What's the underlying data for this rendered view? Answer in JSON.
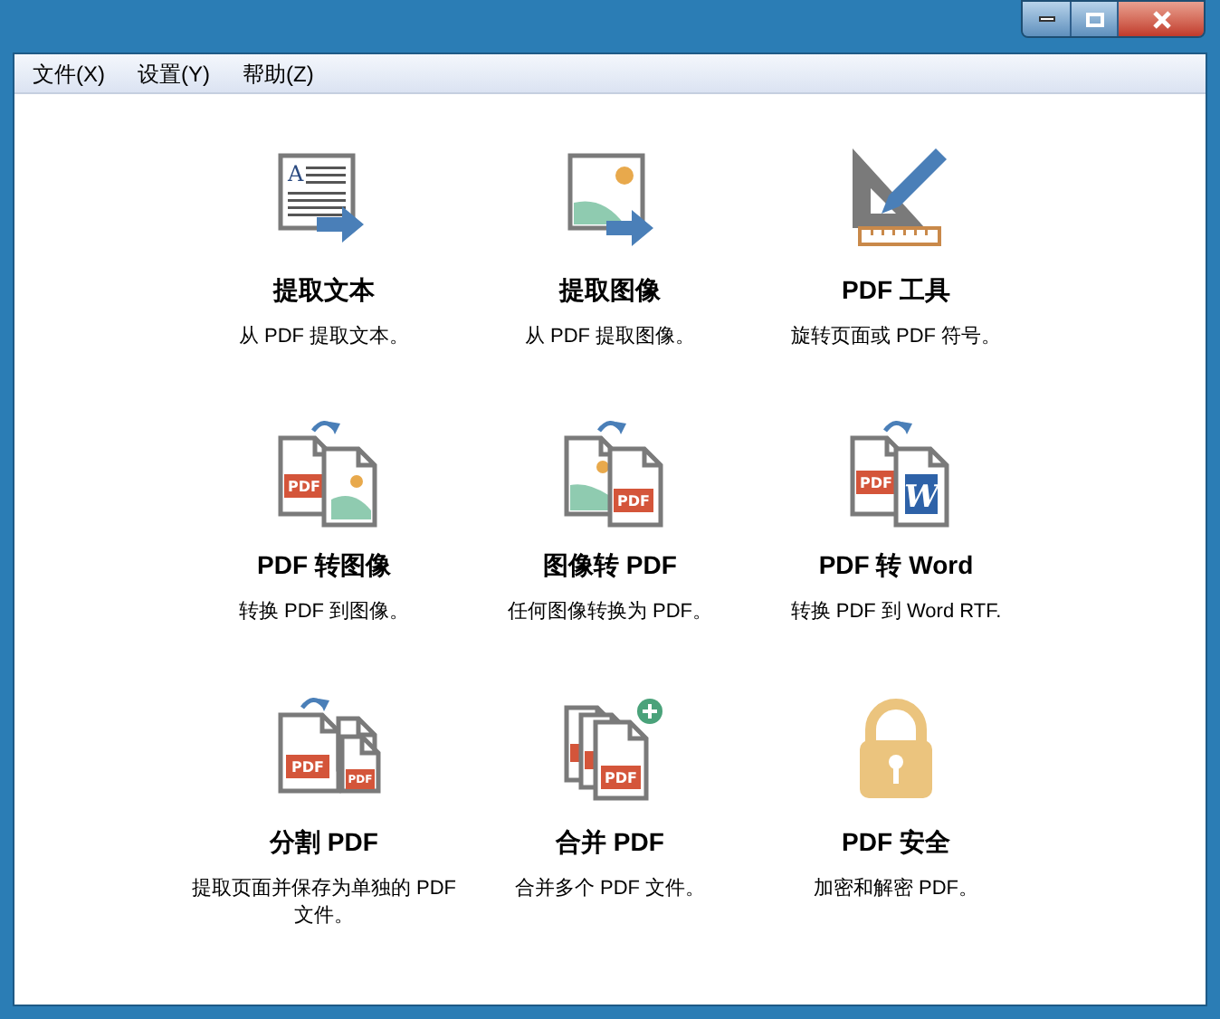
{
  "menu": [
    {
      "label": "文件(X)"
    },
    {
      "label": "设置(Y)"
    },
    {
      "label": "帮助(Z)"
    }
  ],
  "tools": [
    {
      "kind": "extract-text",
      "title": "提取文本",
      "description": "从 PDF 提取文本。",
      "badges": [
        "A"
      ]
    },
    {
      "kind": "extract-image",
      "title": "提取图像",
      "description": "从 PDF 提取图像。"
    },
    {
      "kind": "tools",
      "title": "PDF 工具",
      "description": "旋转页面或 PDF 符号。"
    },
    {
      "kind": "pdf-to-image",
      "title": "PDF 转图像",
      "description": "转换 PDF 到图像。",
      "badges": [
        "PDF"
      ]
    },
    {
      "kind": "image-to-pdf",
      "title": "图像转 PDF",
      "description": "任何图像转换为 PDF。",
      "badges": [
        "PDF"
      ]
    },
    {
      "kind": "pdf-to-word",
      "title": "PDF 转 Word",
      "description": "转换 PDF 到 Word RTF.",
      "badges": [
        "PDF",
        "W"
      ]
    },
    {
      "kind": "split",
      "title": "分割 PDF",
      "description": "提取页面并保存为单独的 PDF 文件。",
      "badges": [
        "PDF",
        "PDF"
      ]
    },
    {
      "kind": "merge",
      "title": "合并 PDF",
      "description": "合并多个 PDF 文件。",
      "badges": [
        "PDF"
      ]
    },
    {
      "kind": "security",
      "title": "PDF 安全",
      "description": "加密和解密 PDF。"
    }
  ]
}
